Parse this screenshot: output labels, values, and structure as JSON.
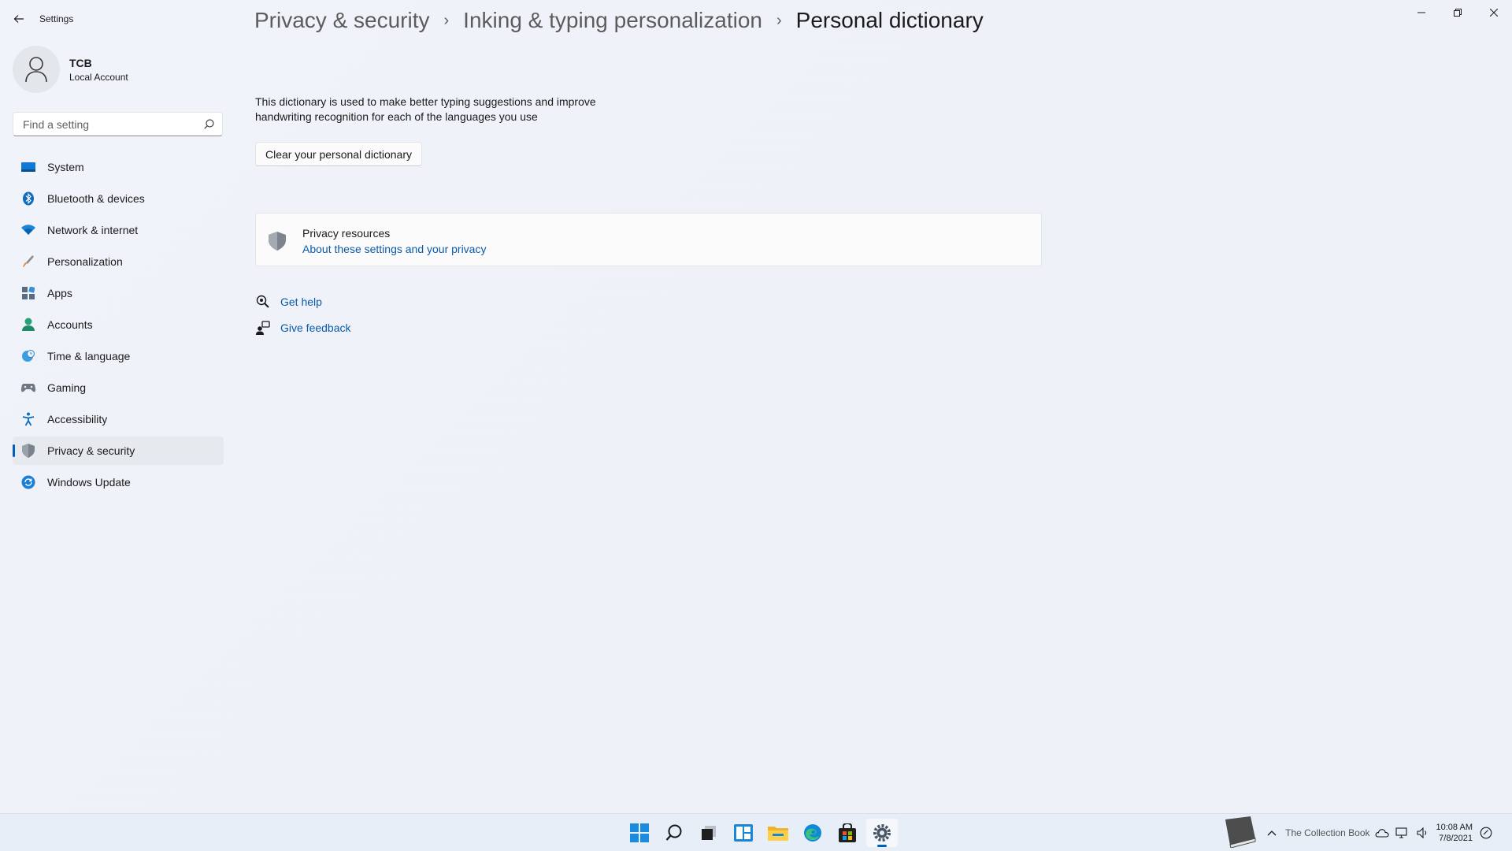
{
  "app": {
    "title": "Settings"
  },
  "user": {
    "name": "TCB",
    "account": "Local Account"
  },
  "search": {
    "placeholder": "Find a setting"
  },
  "nav": {
    "items": [
      {
        "label": "System",
        "icon": "monitor-icon"
      },
      {
        "label": "Bluetooth & devices",
        "icon": "bluetooth-icon"
      },
      {
        "label": "Network & internet",
        "icon": "wifi-icon"
      },
      {
        "label": "Personalization",
        "icon": "brush-icon"
      },
      {
        "label": "Apps",
        "icon": "apps-icon"
      },
      {
        "label": "Accounts",
        "icon": "person-icon"
      },
      {
        "label": "Time & language",
        "icon": "globe-clock-icon"
      },
      {
        "label": "Gaming",
        "icon": "gamepad-icon"
      },
      {
        "label": "Accessibility",
        "icon": "accessibility-icon"
      },
      {
        "label": "Privacy & security",
        "icon": "shield-icon",
        "active": true
      },
      {
        "label": "Windows Update",
        "icon": "update-icon"
      }
    ]
  },
  "breadcrumb": {
    "level1": "Privacy & security",
    "level2": "Inking & typing personalization",
    "current": "Personal dictionary",
    "separator": "›"
  },
  "content": {
    "description": "This dictionary is used to make better typing suggestions and improve handwriting recognition for each of the languages you use",
    "clear_button": "Clear your personal dictionary",
    "privacy_card": {
      "title": "Privacy resources",
      "link": "About these settings and your privacy"
    },
    "get_help": "Get help",
    "give_feedback": "Give feedback"
  },
  "taskbar": {
    "apps": [
      "windows-start-icon",
      "search-icon",
      "task-view-icon",
      "widgets-icon",
      "file-explorer-icon",
      "edge-icon",
      "store-icon",
      "settings-icon"
    ],
    "tray_overlay_text": "The Collection Book",
    "time": "10:08 AM",
    "date": "7/8/2021"
  },
  "colors": {
    "accent": "#005fb8",
    "link": "#0a5aab",
    "background": "#f0f4fa"
  }
}
